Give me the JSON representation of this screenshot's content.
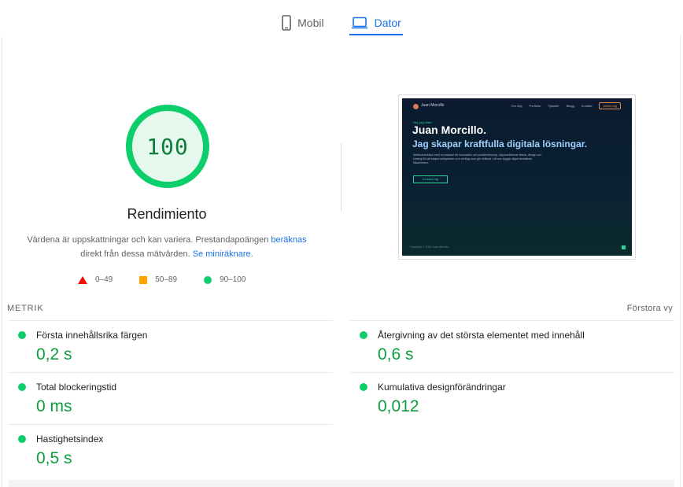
{
  "tabs": [
    {
      "label": "Mobil",
      "icon": "mobile-phone-icon",
      "active": false
    },
    {
      "label": "Dator",
      "icon": "laptop-icon",
      "active": true
    }
  ],
  "colors": {
    "accent": "#1a73e8",
    "pass": "#0cce6b",
    "pass_text": "#0c9d3d",
    "average": "#ffa400",
    "fail": "#eb0f00"
  },
  "category": {
    "score": "100",
    "score_fraction": 1.0,
    "title": "Rendimiento",
    "desc_text": "Värdena är uppskattningar och kan variera. Prestandapoängen ",
    "desc_link1": "beräknas",
    "desc_text2": "direkt från dessa mätvärden.",
    "desc_link2": "Se miniräknare."
  },
  "legend": [
    {
      "range": "0–49",
      "icon": "triangle-icon"
    },
    {
      "range": "50–89",
      "icon": "square-icon"
    },
    {
      "range": "90–100",
      "icon": "circle-icon"
    }
  ],
  "screenshot": {
    "logo": "Juan Morcillo",
    "nav": [
      "Om mig",
      "Portfolio",
      "Tjänster",
      "Blogg",
      "Kontakt"
    ],
    "cta": "Anlita mig",
    "kicker": "Hej, jag heter",
    "headline": "Juan Morcillo.",
    "subheadline": "Jag skapar kraftfulla digitala lösningar.",
    "body": "Webbutvecklare med en passion för innovation och problemlösning. Jag kombinerar teknik, design och strategi för att skapa webbplatser och verktyg som gör skillnad. Låt oss bygga något fantastiskt tillsammans.",
    "button": "Kontakta mig",
    "footer": "Copyright © 2024 Juan Morcillo"
  },
  "metrics": {
    "label": "METRIK",
    "toggle": "Förstora vy",
    "left": [
      {
        "title": "Första innehållsrika färgen",
        "value": "0,2 s"
      },
      {
        "title": "Total blockeringstid",
        "value": "0 ms"
      },
      {
        "title": "Hastighetsindex",
        "value": "0,5 s"
      }
    ],
    "right": [
      {
        "title": "Återgivning av det största elementet med innehåll",
        "value": "0,6 s"
      },
      {
        "title": "Kumulativa designförändringar",
        "value": "0,012"
      }
    ]
  }
}
